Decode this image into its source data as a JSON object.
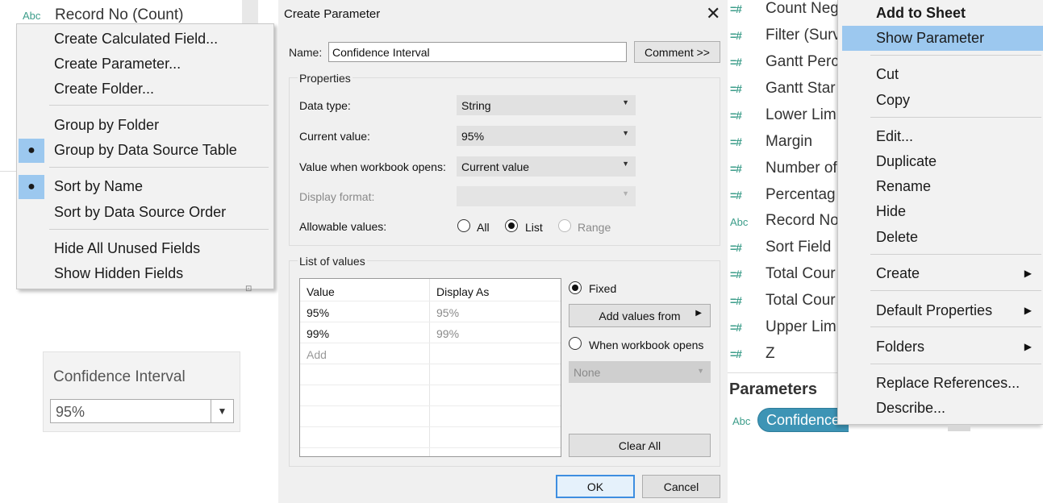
{
  "left_panel": {
    "top_field": {
      "icon": "Abc",
      "label": "Record No (Count)"
    },
    "context_menu": {
      "items": [
        {
          "label": "Create Calculated Field...",
          "checked": false
        },
        {
          "label": "Create Parameter...",
          "checked": false
        },
        {
          "label": "Create Folder...",
          "checked": false
        },
        {
          "label": "Group by Folder",
          "checked": false
        },
        {
          "label": "Group by Data Source Table",
          "checked": true
        },
        {
          "label": "Sort by Name",
          "checked": true
        },
        {
          "label": "Sort by Data Source Order",
          "checked": false
        },
        {
          "label": "Hide All Unused Fields",
          "checked": false
        },
        {
          "label": "Show Hidden Fields",
          "checked": false
        }
      ]
    },
    "parameter_card": {
      "title": "Confidence Interval",
      "value": "95%"
    }
  },
  "dialog": {
    "title": "Create Parameter",
    "name_label": "Name:",
    "name_value": "Confidence Interval",
    "comment_button": "Comment >>",
    "properties": {
      "title": "Properties",
      "data_type_label": "Data type:",
      "data_type_value": "String",
      "current_value_label": "Current value:",
      "current_value_value": "95%",
      "workbook_opens_label": "Value when workbook opens:",
      "workbook_opens_value": "Current value",
      "display_format_label": "Display format:",
      "display_format_value": "",
      "allowable_label": "Allowable values:",
      "allowable_options": [
        {
          "label": "All",
          "checked": false,
          "disabled": false
        },
        {
          "label": "List",
          "checked": true,
          "disabled": false
        },
        {
          "label": "Range",
          "checked": false,
          "disabled": true
        }
      ]
    },
    "list_of_values": {
      "title": "List of values",
      "columns": [
        "Value",
        "Display As"
      ],
      "rows": [
        {
          "value": "95%",
          "display": "95%"
        },
        {
          "value": "99%",
          "display": "99%"
        }
      ],
      "add_placeholder": "Add",
      "fixed_label": "Fixed",
      "add_values_from": "Add values from",
      "when_workbook_opens_label": "When workbook opens",
      "when_workbook_opens_value": "None",
      "clear_all": "Clear All"
    },
    "ok_button": "OK",
    "cancel_button": "Cancel"
  },
  "data_pane": {
    "fields": [
      {
        "icon": "=#",
        "label": "Count Neg"
      },
      {
        "icon": "=#",
        "label": "Filter (Surv"
      },
      {
        "icon": "=#",
        "label": "Gantt Perc"
      },
      {
        "icon": "=#",
        "label": "Gantt Star"
      },
      {
        "icon": "=#",
        "label": "Lower Lim"
      },
      {
        "icon": "=#",
        "label": "Margin"
      },
      {
        "icon": "=#",
        "label": "Number of"
      },
      {
        "icon": "=#",
        "label": "Percentag"
      },
      {
        "icon": "Abc",
        "label": "Record No"
      },
      {
        "icon": "=#",
        "label": "Sort Field"
      },
      {
        "icon": "=#",
        "label": "Total Cour"
      },
      {
        "icon": "=#",
        "label": "Total Cour"
      },
      {
        "icon": "=#",
        "label": "Upper Lim"
      },
      {
        "icon": "=#",
        "label": "Z"
      }
    ],
    "parameters_header": "Parameters",
    "parameter_icon": "Abc",
    "parameter_pill": "Confidence Interval"
  },
  "right_menu": {
    "items": [
      {
        "label": "Add to Sheet",
        "bold": true,
        "highlight": false,
        "submenu": false
      },
      {
        "label": "Show Parameter",
        "bold": false,
        "highlight": true,
        "submenu": false
      },
      {
        "label": "Cut",
        "bold": false,
        "highlight": false,
        "submenu": false
      },
      {
        "label": "Copy",
        "bold": false,
        "highlight": false,
        "submenu": false
      },
      {
        "label": "Edit...",
        "bold": false,
        "highlight": false,
        "submenu": false
      },
      {
        "label": "Duplicate",
        "bold": false,
        "highlight": false,
        "submenu": false
      },
      {
        "label": "Rename",
        "bold": false,
        "highlight": false,
        "submenu": false
      },
      {
        "label": "Hide",
        "bold": false,
        "highlight": false,
        "submenu": false
      },
      {
        "label": "Delete",
        "bold": false,
        "highlight": false,
        "submenu": false
      },
      {
        "label": "Create",
        "bold": false,
        "highlight": false,
        "submenu": true
      },
      {
        "label": "Default Properties",
        "bold": false,
        "highlight": false,
        "submenu": true
      },
      {
        "label": "Folders",
        "bold": false,
        "highlight": false,
        "submenu": true
      },
      {
        "label": "Replace References...",
        "bold": false,
        "highlight": false,
        "submenu": false
      },
      {
        "label": "Describe...",
        "bold": false,
        "highlight": false,
        "submenu": false
      }
    ]
  },
  "colors": {
    "menu_highlight": "#9cc8ef",
    "field_icon": "#3c9d8a",
    "parameter_pill": "#3d94b5",
    "primary_button_border": "#3e8ee0"
  }
}
